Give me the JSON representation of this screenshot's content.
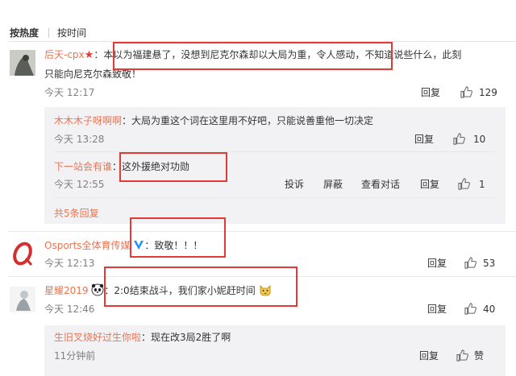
{
  "sort": {
    "hot": "按热度",
    "time": "按时间"
  },
  "comments": [
    {
      "user": "后天-cpx",
      "text_line1": "：本以为福建悬了，没想到尼克尔森却以大局为重，令人感动，不知道说些什么，此刻",
      "text_line2": "只能向尼克尔森致敬！",
      "time": "今天 12:17",
      "reply": "回复",
      "likes": "129",
      "replies": [
        {
          "user": "木木木子呀啊啊",
          "text": "：大局为重这个词在这里用不好吧，只能说善重他一切决定",
          "time": "今天 13:28",
          "reply": "回复",
          "likes": "10"
        },
        {
          "user": "下一站会有谁",
          "text": "：这外援绝对功勋",
          "time": "今天 12:55",
          "report": "投诉",
          "block": "屏蔽",
          "view_conv": "查看对话",
          "reply": "回复",
          "likes": "1"
        }
      ],
      "more": "共5条回复"
    },
    {
      "user": "Osports全体育传媒",
      "text": "：致敬！！！",
      "time": "今天 12:13",
      "reply": "回复",
      "likes": "53"
    },
    {
      "user": "星耀2019",
      "text": "：2:0结束战斗，我们家小妮赶时间",
      "time": "今天 12:46",
      "reply": "回复",
      "likes": "40",
      "replies": [
        {
          "user": "生旧叉烧好过生你啦",
          "text": "：现在改3局2胜了啊",
          "time": "11分钟前",
          "reply": "回复",
          "likes": "赞"
        }
      ]
    }
  ],
  "colors": {
    "username": "#eb7350",
    "highlight_box": "#e53935",
    "sub_bg": "#f2f2f5"
  },
  "icons": {
    "star": "red-star-icon",
    "verified": "blue-v-icon",
    "like": "thumb-up-icon",
    "emoji_panda": "panda-emoji-icon",
    "emoji_cat": "cat-emoji-icon"
  }
}
